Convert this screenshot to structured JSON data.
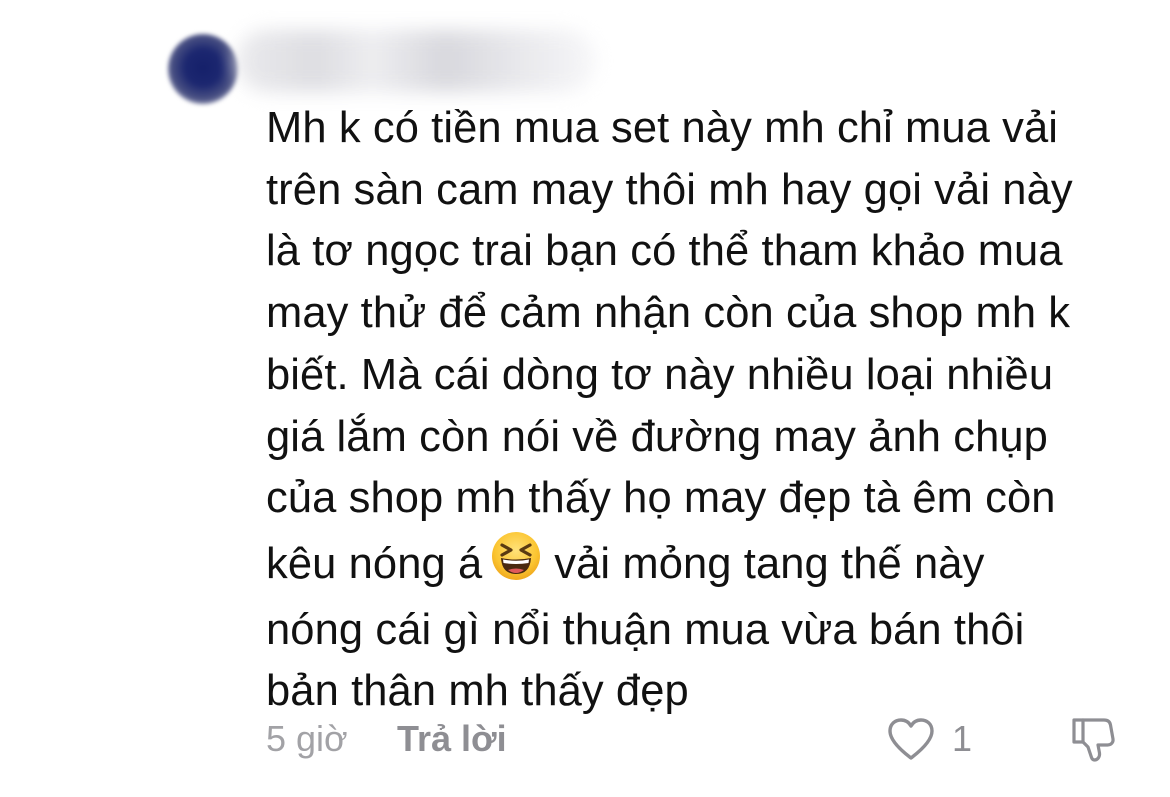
{
  "comment": {
    "author_avatar_icon": "blurred-avatar",
    "author_name_icon": "blurred-username",
    "text_lines": [
      "Mh k có tiền mua set này mh chỉ mua vải",
      "trên sàn cam may thôi mh hay gọi vải này",
      "là tơ ngọc trai bạn có thể tham khảo mua",
      "may thử để cảm nhận còn của shop mh k",
      "biết. Mà cái dòng tơ này nhiều loại nhiều",
      "giá lắm còn nói về đường may ảnh chụp",
      "của shop mh thấy họ may đẹp tà êm còn"
    ],
    "line_with_emoji": {
      "before": "kêu nóng á",
      "emoji_icon": "grinning-squinting-face-emoji",
      "after": "vải mỏng tang thế này"
    },
    "text_lines_after": [
      "nóng cái gì nổi thuận mua vừa bán thôi",
      "bản thân mh thấy đẹp"
    ],
    "time_ago": "5 giờ",
    "reply_label": "Trả lời",
    "like_icon": "heart-outline-icon",
    "like_count": "1",
    "dislike_icon": "thumbs-down-icon"
  },
  "colors": {
    "text": "#111111",
    "meta_text": "#a2a2a6",
    "icon_stroke": "#8e8e93"
  }
}
